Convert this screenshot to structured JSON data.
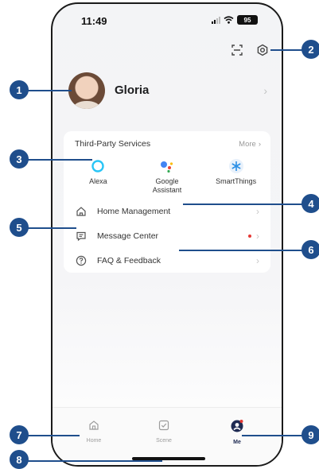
{
  "status_bar": {
    "time": "11:49",
    "battery": "95"
  },
  "header": {
    "scan_icon": "scan-icon",
    "settings_icon": "settings-gear-icon"
  },
  "profile": {
    "name": "Gloria",
    "chevron": "›"
  },
  "third_party": {
    "title": "Third-Party Services",
    "more_label": "More",
    "services": [
      {
        "label": "Alexa",
        "icon": "alexa-icon"
      },
      {
        "label": "Google\nAssistant",
        "icon": "google-assistant-icon"
      },
      {
        "label": "SmartThings",
        "icon": "smartthings-icon"
      }
    ]
  },
  "menu": [
    {
      "label": "Home Management",
      "icon": "home-icon"
    },
    {
      "label": "Message Center",
      "icon": "message-icon",
      "has_unread_dot": true
    },
    {
      "label": "FAQ & Feedback",
      "icon": "help-icon"
    }
  ],
  "tabs": [
    {
      "label": "Home",
      "icon": "home-icon"
    },
    {
      "label": "Scene",
      "icon": "scene-checkbox-icon"
    },
    {
      "label": "Me",
      "icon": "person-icon",
      "active": true
    }
  ],
  "callouts": [
    "1",
    "2",
    "3",
    "4",
    "5",
    "6",
    "7",
    "8",
    "9"
  ],
  "colors": {
    "callout": "#1f4e8c",
    "alexa": "#29c5f6",
    "smartthings": "#2b8fe5",
    "active_tab": "#1e2a52",
    "unread_dot": "#e53935"
  }
}
